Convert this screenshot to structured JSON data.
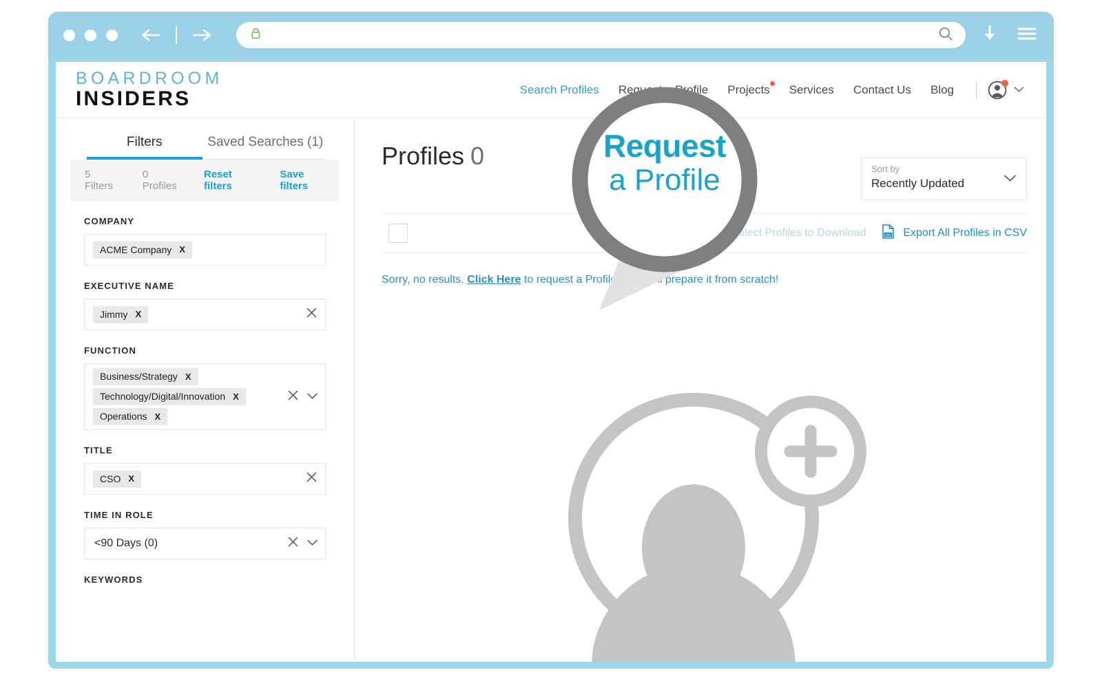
{
  "browser": {
    "traffic_dots": 3,
    "back_icon": "back-arrow-icon",
    "forward_icon": "forward-arrow-icon",
    "address_value": "",
    "address_placeholder": "",
    "lock_icon": "padlock-icon",
    "search_icon": "search-icon",
    "download_icon": "download-arrow-icon",
    "menu_icon": "hamburger-menu-icon",
    "frame_color": "#9ed7ea"
  },
  "header": {
    "logo_top": "BOARDROOM",
    "logo_bottom": "INSIDERS",
    "logo_top_color": "#5cb3dd",
    "nav": [
      {
        "label": "Search Profiles",
        "active": true,
        "dot": false
      },
      {
        "label": "Request a Profile",
        "active": false,
        "dot": false
      },
      {
        "label": "Projects",
        "active": false,
        "dot": true
      },
      {
        "label": "Services",
        "active": false,
        "dot": false
      },
      {
        "label": "Contact Us",
        "active": false,
        "dot": false
      },
      {
        "label": "Blog",
        "active": false,
        "dot": false
      }
    ],
    "avatar_icon": "user-avatar-icon",
    "avatar_badge_color": "#f4603e",
    "avatar_caret": "chevron-down-icon"
  },
  "sidebar": {
    "tabs": [
      {
        "label": "Filters",
        "active": true
      },
      {
        "label": "Saved Searches (1)",
        "active": false
      }
    ],
    "summary": {
      "filters_count": "5 Filters",
      "profiles_count": "0 Profiles",
      "reset_label": "Reset filters",
      "save_label": "Save filters"
    },
    "groups": [
      {
        "label": "COMPANY",
        "chips": [
          "ACME Company"
        ],
        "value": "",
        "has_clear": false,
        "has_caret": false
      },
      {
        "label": "EXECUTIVE NAME",
        "chips": [
          "Jimmy"
        ],
        "value": "",
        "has_clear": true,
        "has_caret": false
      },
      {
        "label": "FUNCTION",
        "chips": [
          "Business/Strategy",
          "Technology/Digital/Innovation",
          "Operations"
        ],
        "value": "",
        "has_clear": true,
        "has_caret": true
      },
      {
        "label": "TITLE",
        "chips": [
          "CSO"
        ],
        "value": "",
        "has_clear": true,
        "has_caret": false
      },
      {
        "label": "TIME IN ROLE",
        "chips": [],
        "value": "<90 Days (0)",
        "has_clear": true,
        "has_caret": true
      },
      {
        "label": "KEYWORDS",
        "chips": [],
        "value": "",
        "has_clear": false,
        "has_caret": false
      }
    ],
    "chip_remove_glyph": "X"
  },
  "main": {
    "results_title": "Profiles",
    "results_count": "0",
    "sort": {
      "label": "Sort by",
      "value": "Recently Updated",
      "caret_icon": "chevron-down-icon"
    },
    "toolbar": {
      "select_all_checkbox": "",
      "download_icon": "download-tray-icon",
      "select_label": "Select Profiles to Download",
      "csv_icon": "csv-file-icon",
      "export_label": "Export All Profiles in CSV"
    },
    "no_results": {
      "prefix": "Sorry, no results. ",
      "link": "Click Here",
      "suffix": " to request a Profile and we'll prepare it from scratch!"
    },
    "empty_illustration": "add-person-icon"
  },
  "callout": {
    "line1": "Request",
    "line2": "a Profile",
    "text_color": "#18a3cd",
    "ring_color": "#7f7f7f",
    "icon": "magnifier-callout-icon"
  }
}
